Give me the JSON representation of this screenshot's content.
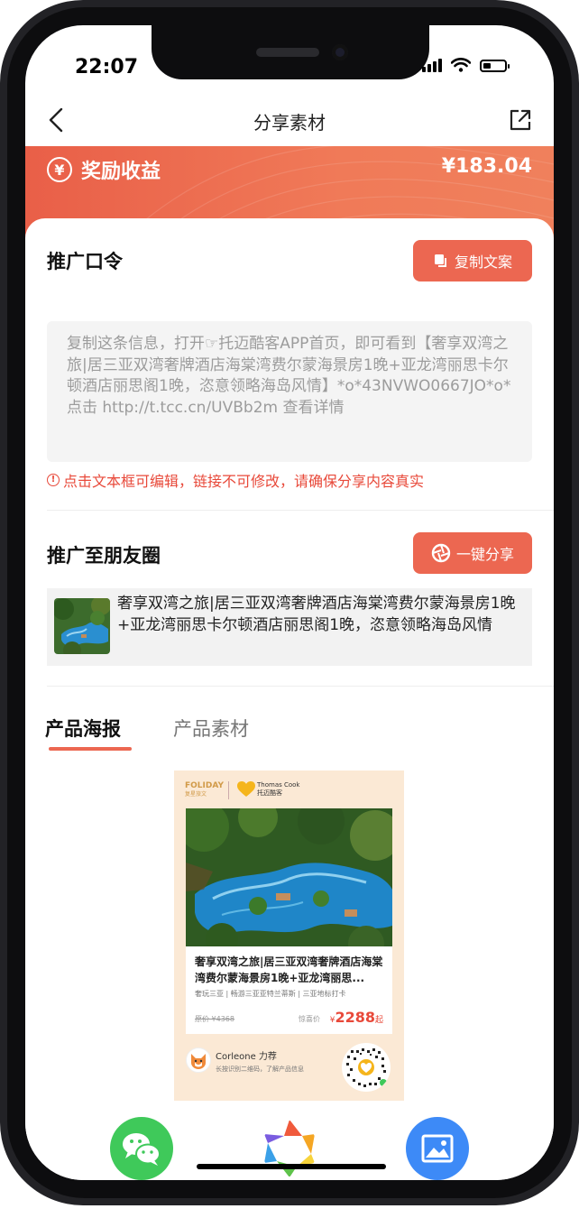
{
  "status_bar": {
    "time": "22:07"
  },
  "nav": {
    "title": "分享素材",
    "back_icon": "chevron-left-icon",
    "share_icon": "share-out-icon"
  },
  "reward": {
    "label": "奖励收益",
    "amount": "¥183.04",
    "icon_glyph": "¥"
  },
  "promo_code": {
    "heading": "推广口令",
    "copy_button": "复制文案",
    "text": "复制这条信息，打开☞托迈酷客APP首页，即可看到【奢享双湾之旅|居三亚双湾奢牌酒店海棠湾费尔蒙海景房1晚+亚龙湾丽思卡尔顿酒店丽思阁1晚，恣意领略海岛风情】*o*43NVWO0667JO*o*点击 http://t.tcc.cn/UVBb2m 查看详情",
    "warning_icon": "!",
    "warning": "点击文本框可编辑，链接不可修改，请确保分享内容真实"
  },
  "moments": {
    "heading": "推广至朋友圈",
    "share_button": "一键分享",
    "text": "奢享双湾之旅|居三亚双湾奢牌酒店海棠湾费尔蒙海景房1晚+亚龙湾丽思卡尔顿酒店丽思阁1晚，恣意领略海岛风情"
  },
  "tabs": [
    {
      "label": "产品海报",
      "active": true
    },
    {
      "label": "产品素材",
      "active": false
    }
  ],
  "poster": {
    "brand1": "FOLIDAY",
    "brand1_sub": "复星旅文",
    "brand2": "Thomas Cook",
    "brand2_sub": "托迈酷客",
    "title": "奢享双湾之旅|居三亚双湾奢牌酒店海棠湾费尔蒙海景房1晚+亚龙湾丽思...",
    "subtitle": "奢玩三亚 | 畅游三亚亚特兰蒂斯 | 三亚地标打卡",
    "original_price": "原价 ¥4368",
    "price_label": "惊喜价",
    "price_symbol": "¥",
    "price": "2288",
    "price_suffix": "起",
    "recommender": "Corleone 力荐",
    "hint": "长按识别二维码，了解产品信息"
  },
  "bottom_actions": [
    {
      "name": "wechat",
      "color": "#3fc95a"
    },
    {
      "name": "moments",
      "color": "#ffffff"
    },
    {
      "name": "save-image",
      "color": "#3d8af7"
    }
  ],
  "colors": {
    "accent": "#ec6751",
    "warning": "#e8493a"
  }
}
